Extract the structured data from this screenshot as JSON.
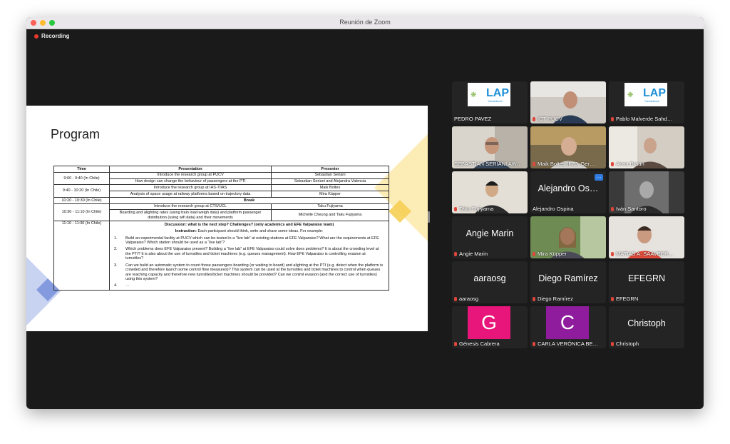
{
  "window": {
    "title": "Reunión de Zoom",
    "recording": "Recording"
  },
  "colors": {
    "active_speaker": "#25c54c",
    "mic_muted": "#e0463a",
    "genesis_avatar": "#e8157a",
    "carla_avatar": "#8e1c9c"
  },
  "slide": {
    "title": "Program",
    "headers": {
      "time": "Time",
      "presentation": "Presentation",
      "presenter": "Presenter"
    },
    "rows": [
      {
        "time": "9:00 - 9:40 (In Chile)",
        "p1": "Introduce the research group at PUCV",
        "r1": "Sebastian Seriani",
        "p2": "How design can change the behaviour of passengers at the PTI",
        "r2": "Sebastian Seriani and Alejandra Valencia"
      },
      {
        "time": "9:40 - 10:20 (In Chile)",
        "p1": "Introduce the research group at IAS-7/IAS",
        "r1": "Maik Boltes",
        "p2": "Analysis of space usage at railway platforms based on trajectory data",
        "r2": "Mira Küpper"
      },
      {
        "time": "10:20 - 10:30 (In Chile)",
        "break": "Break"
      },
      {
        "time": "10:30 - 11:10 (In Chile)",
        "p1": "Introduce the research group at CTS/UCL",
        "r1": "Taku Fujiyama",
        "p2": "Boarding and alighting rates (using train load-weigh data) and platform passenger distribution (using wifi data) and their movements",
        "r2": "Michelle Cheung and Taku Fujiyama"
      }
    ],
    "discussion": {
      "time": "11:10 - 11:30 (In Chile)",
      "heading": "Discussion: what is the next step? Challenges? (only academics and EFE Valparaiso team)",
      "instruction_label": "Instruction:",
      "instruction": "Each participant should think, write and share some ideas. For example:",
      "items": [
        {
          "num": "1.",
          "text": "Build an experimental facility at PUCV which can be tested in a “live lab” at existing stations at EFE Valparaiso? What are the requirements at EFE Valparaiso? Which station should be used as a “live lab”?"
        },
        {
          "num": "2.",
          "text": "Which problems does EFE Valparaiso present? Building a “live lab” at EFE Valparaiso could solve does problems? It is about the crowding level at the PTI? It is also about the use of turnstiles and ticket machines (e.g. queues management). How EFE Valparaiso is controlling evasion at turnstiles?"
        },
        {
          "num": "3.",
          "text": "Can we build an automatic system to count those passengers boarding (or waiting to board) and alighting at the PTI (e.g. detect when the platform is crowded and therefore launch some control flow measures)? This system can be used at the turnstiles and ticket machines to control when queues are reaching capacity and therefore new turnstiles/ticket machines should be provided? Can we control evasion (and the correct use of turnstiles) using this system?"
        },
        {
          "num": "4.",
          "text": "…"
        }
      ]
    }
  },
  "participants": [
    {
      "label": "PEDRO PAVEZ",
      "big": "",
      "kind": "logo",
      "muted": false
    },
    {
      "label": "ICT PUCV",
      "big": "",
      "kind": "video",
      "muted": true
    },
    {
      "label": "Pablo Malverde Sahd…",
      "big": "",
      "kind": "logo",
      "muted": true
    },
    {
      "label": "SEBASTIAN SERIANI AW…",
      "big": "",
      "kind": "video",
      "muted": false
    },
    {
      "label": "Maik Boltes (FZJ, Ger…",
      "big": "",
      "kind": "video",
      "muted": true
    },
    {
      "label": "Anna Braun",
      "big": "",
      "kind": "video",
      "muted": true
    },
    {
      "label": "Taku Fujiyama",
      "big": "",
      "kind": "video",
      "muted": true
    },
    {
      "label": "Alejandro Ospina",
      "big": "Alejandro Os…",
      "kind": "name",
      "muted": false
    },
    {
      "label": "Iván Santoro",
      "big": "",
      "kind": "video",
      "muted": true
    },
    {
      "label": "Angie Marin",
      "big": "Angie Marin",
      "kind": "name",
      "muted": true
    },
    {
      "label": "Mira Küpper",
      "big": "",
      "kind": "video",
      "muted": true
    },
    {
      "label": "MATIAS A. SAAVEDR…",
      "big": "",
      "kind": "video",
      "muted": true
    },
    {
      "label": "aaraosg",
      "big": "aaraosg",
      "kind": "name",
      "muted": true
    },
    {
      "label": "Diego Ramírez",
      "big": "Diego Ramírez",
      "kind": "name",
      "muted": true
    },
    {
      "label": "EFEGRN",
      "big": "EFEGRN",
      "kind": "name",
      "muted": true
    },
    {
      "label": "Génesis Cabrera",
      "big": "G",
      "kind": "avatar",
      "muted": true
    },
    {
      "label": "CARLA VERÓNICA BE…",
      "big": "C",
      "kind": "avatar",
      "muted": true
    },
    {
      "label": "Christoph",
      "big": "Christoph",
      "kind": "name",
      "muted": true
    }
  ],
  "logo": {
    "text": "LAP",
    "sub": "Transtelecom"
  },
  "more_button": "…"
}
